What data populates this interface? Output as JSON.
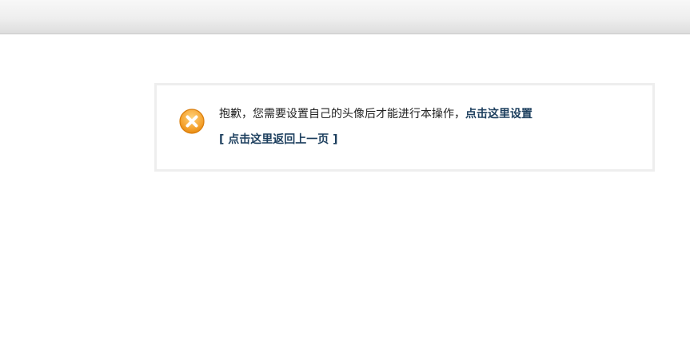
{
  "message": {
    "text": "抱歉，您需要设置自己的头像后才能进行本操作，",
    "settings_link": "点击这里设置",
    "back_link": "[ 点击这里返回上一页 ]"
  },
  "icon": {
    "name": "error-x-icon",
    "color_outer": "#f39c1e",
    "color_inner": "#f7b04a"
  },
  "colors": {
    "link": "#1d3f5e",
    "border": "#eeeeee"
  }
}
